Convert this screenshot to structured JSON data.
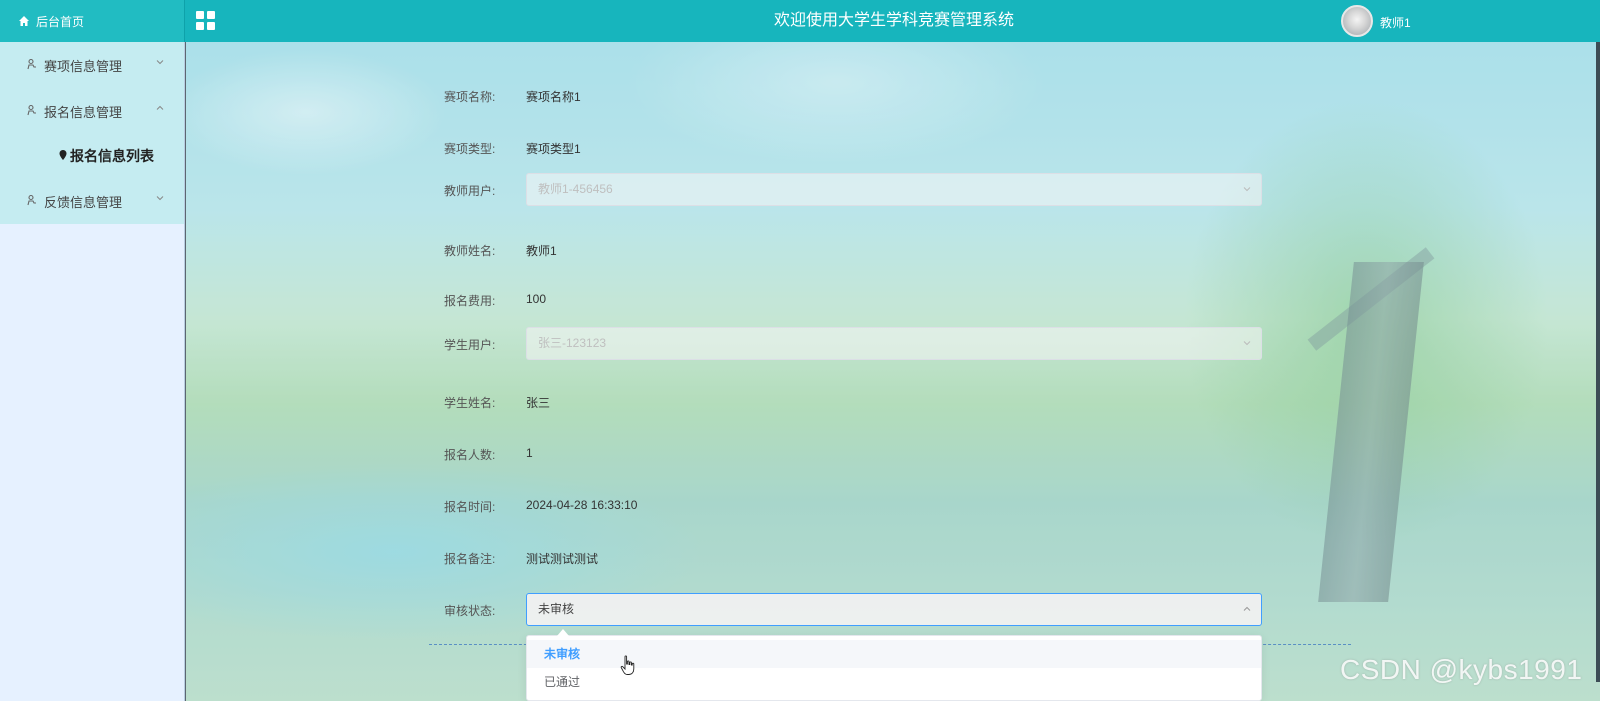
{
  "header": {
    "home_label": "后台首页",
    "title": "欢迎使用大学生学科竞赛管理系统",
    "username": "教师1",
    "menu_toggle_icon": "grid-icon",
    "colors": {
      "bar": "#17b5bd",
      "sidebar": "#e6f1ff",
      "menu_block": "#c5ecf1",
      "accent": "#409eff"
    }
  },
  "sidebar": {
    "items": [
      {
        "label": "赛项信息管理",
        "icon": "user-icon",
        "expanded": false
      },
      {
        "label": "报名信息管理",
        "icon": "user-icon",
        "expanded": true,
        "children": [
          {
            "label": "报名信息列表",
            "icon": "pin-icon"
          }
        ]
      },
      {
        "label": "反馈信息管理",
        "icon": "user-icon",
        "expanded": false
      }
    ]
  },
  "form": {
    "contest_name": {
      "label": "赛项名称:",
      "value": "赛项名称1"
    },
    "contest_type": {
      "label": "赛项类型:",
      "value": "赛项类型1"
    },
    "teacher_user": {
      "label": "教师用户:",
      "value": "教师1-456456"
    },
    "teacher_name": {
      "label": "教师姓名:",
      "value": "教师1"
    },
    "fee": {
      "label": "报名费用:",
      "value": "100"
    },
    "student_user": {
      "label": "学生用户:",
      "value": "张三-123123"
    },
    "student_name": {
      "label": "学生姓名:",
      "value": "张三"
    },
    "count": {
      "label": "报名人数:",
      "value": "1"
    },
    "time": {
      "label": "报名时间:",
      "value": "2024-04-28 16:33:10"
    },
    "remark": {
      "label": "报名备注:",
      "value": "测试测试测试"
    },
    "review_status": {
      "label": "审核状态:",
      "value": "未审核",
      "options": [
        "未审核",
        "已通过"
      ],
      "selected_index": 0
    }
  },
  "watermark": "CSDN @kybs1991"
}
